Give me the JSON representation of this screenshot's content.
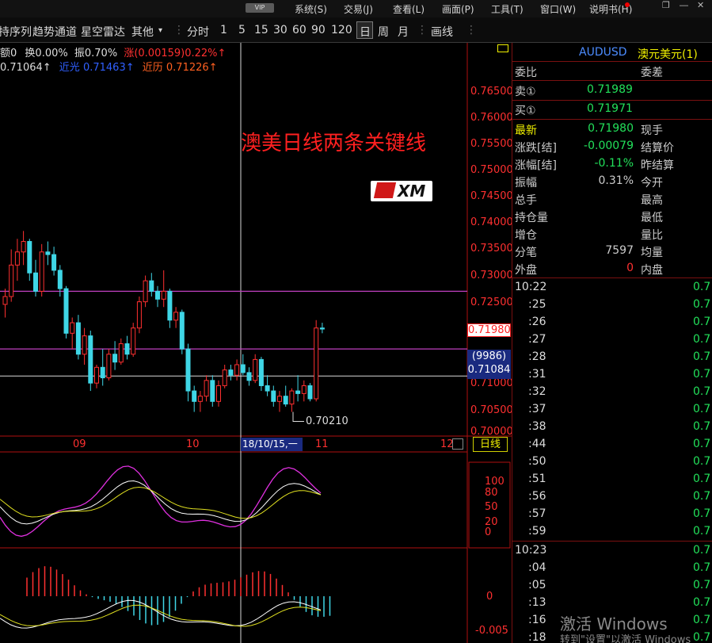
{
  "menu": {
    "vip": "VIP",
    "items": [
      "系统(S)",
      "交易(J)",
      "查看(L)",
      "画面(P)",
      "工具(T)",
      "窗口(W)",
      "说明书(H)"
    ]
  },
  "toolbar": {
    "items": [
      "持序列",
      "趋势通道",
      "星空雷达",
      "其他",
      "分时",
      "1",
      "5",
      "15",
      "30",
      "60",
      "90",
      "120",
      "日",
      "周",
      "月",
      "画线"
    ],
    "selected": "日"
  },
  "info": {
    "row1": {
      "amount": "额0",
      "turnover": "换0.00%",
      "amplitude": "振0.70%",
      "change": "涨(0.00159)0.22%↑"
    },
    "row2": {
      "price1": "0.71064↑",
      "recent_label": "近光",
      "recent": "0.71463↑",
      "near_label": "近历",
      "near": "0.71226↑"
    }
  },
  "chart": {
    "annotation": "澳美日线两条关键线",
    "logo": "XM",
    "low_label": "0.70210",
    "price_axis": [
      "0.76500",
      "0.76000",
      "0.75500",
      "0.75000",
      "0.74500",
      "0.74000",
      "0.73500",
      "0.73000",
      "0.72500",
      "0.71980",
      "0.71000",
      "0.70500",
      "0.70000"
    ],
    "current_price": "0.71980",
    "cursor_vol": "(9986)",
    "cursor_price": "0.71084",
    "date_axis": [
      "09",
      "10",
      "11",
      "12"
    ],
    "cursor_date": "18/10/15,一",
    "period_button": "日线",
    "kdj_axis": [
      "100",
      "80",
      "50",
      "20",
      "0"
    ],
    "macd_axis": [
      "0",
      "-0.005"
    ],
    "key_lines": [
      0.727,
      0.716
    ],
    "cursor_line": 0.71084,
    "colors": {
      "up": "#ff3030",
      "down": "#3fd6e6",
      "key_line": "#c040c0",
      "axis": "#b01010",
      "cursor": "#d8d8d8"
    }
  },
  "panel": {
    "symbol": "AUDUSD",
    "name": "澳元美元(1)",
    "header": {
      "left": "委比",
      "right": "委差"
    },
    "sell_label": "卖①",
    "sell": "0.71989",
    "buy_label": "买①",
    "buy": "0.71971",
    "rows": [
      {
        "label": "最新",
        "value": "0.71980",
        "label2": "现手"
      },
      {
        "label": "涨跌[结]",
        "value": "-0.00079",
        "label2": "结算价"
      },
      {
        "label": "涨幅[结]",
        "value": "-0.11%",
        "label2": "昨结算"
      },
      {
        "label": "振幅",
        "value": "0.31%",
        "label2": "今开"
      },
      {
        "label": "总手",
        "value": "",
        "label2": "最高"
      },
      {
        "label": "持仓量",
        "value": "",
        "label2": "最低"
      },
      {
        "label": "增仓",
        "value": "",
        "label2": "量比"
      },
      {
        "label": "分笔",
        "value": "7597",
        "label2": "均量"
      },
      {
        "label": "外盘",
        "value": "0",
        "label2": "内盘"
      }
    ],
    "ticks": [
      {
        "time": "10:22",
        "price": "0.7"
      },
      {
        "time": ":25",
        "price": "0.7"
      },
      {
        "time": ":26",
        "price": "0.7"
      },
      {
        "time": ":27",
        "price": "0.7"
      },
      {
        "time": ":28",
        "price": "0.7"
      },
      {
        "time": ":31",
        "price": "0.7"
      },
      {
        "time": ":32",
        "price": "0.7"
      },
      {
        "time": ":37",
        "price": "0.7"
      },
      {
        "time": ":38",
        "price": "0.7"
      },
      {
        "time": ":44",
        "price": "0.7"
      },
      {
        "time": ":50",
        "price": "0.7"
      },
      {
        "time": ":51",
        "price": "0.7"
      },
      {
        "time": ":56",
        "price": "0.7"
      },
      {
        "time": ":57",
        "price": "0.7"
      },
      {
        "time": ":59",
        "price": "0.7"
      },
      {
        "time": "10:23",
        "price": "0.7"
      },
      {
        "time": ":04",
        "price": "0.7"
      },
      {
        "time": ":05",
        "price": "0.7"
      },
      {
        "time": ":13",
        "price": "0.7"
      },
      {
        "time": ":16",
        "price": "0.7"
      },
      {
        "time": ":18",
        "price": "0.7"
      }
    ]
  },
  "watermark": {
    "line1": "激活 Windows",
    "line2": "转到\"设置\"以激活 Windows"
  }
}
